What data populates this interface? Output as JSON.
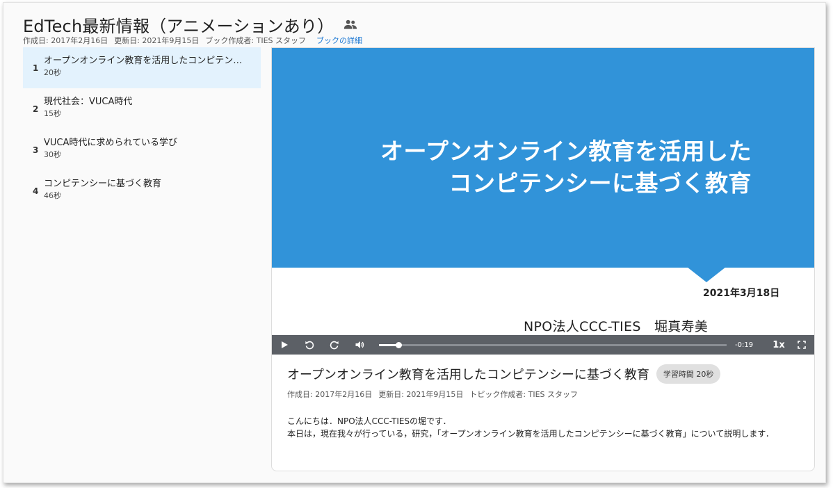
{
  "book": {
    "title": "EdTech最新情報（アニメーションあり）",
    "created": "作成日: 2017年2月16日",
    "updated": "更新日: 2021年9月15日",
    "author": "ブック作成者: TIES スタッフ",
    "details_link": "ブックの詳細"
  },
  "sidebar": {
    "items": [
      {
        "num": "1",
        "title": "オープンオンライン教育を活用したコンピテン…",
        "duration": "20秒"
      },
      {
        "num": "2",
        "title": "現代社会：VUCA時代",
        "duration": "15秒"
      },
      {
        "num": "3",
        "title": "VUCA時代に求められている学び",
        "duration": "30秒"
      },
      {
        "num": "4",
        "title": "コンピテンシーに基づく教育",
        "duration": "46秒"
      }
    ]
  },
  "slide": {
    "title_line1": "オープンオンライン教育を活用した",
    "title_line2": "コンピテンシーに基づく教育",
    "date": "2021年3月18日",
    "author": "NPO法人CCC-TIES　堀真寿美"
  },
  "player": {
    "time_remaining": "-0:19",
    "speed": "1x",
    "progress": 0.055
  },
  "topic": {
    "title": "オープンオンライン教育を活用したコンピテンシーに基づく教育",
    "duration_chip": "学習時間 20秒",
    "created": "作成日: 2017年2月16日",
    "updated": "更新日: 2021年9月15日",
    "author": "トピック作成者: TIES スタッフ",
    "body_line1": "こんにちは．NPO法人CCC-TIESの堀です．",
    "body_line2": "本日は，現在我々が行っている，研究，「オープンオンライン教育を活用したコンピテンシーに基づく教育」について説明します．"
  },
  "colors": {
    "accent": "#3193d9",
    "link": "#1976d2",
    "active_bg": "#e3f2fd",
    "player_bg": "#5c6066"
  }
}
